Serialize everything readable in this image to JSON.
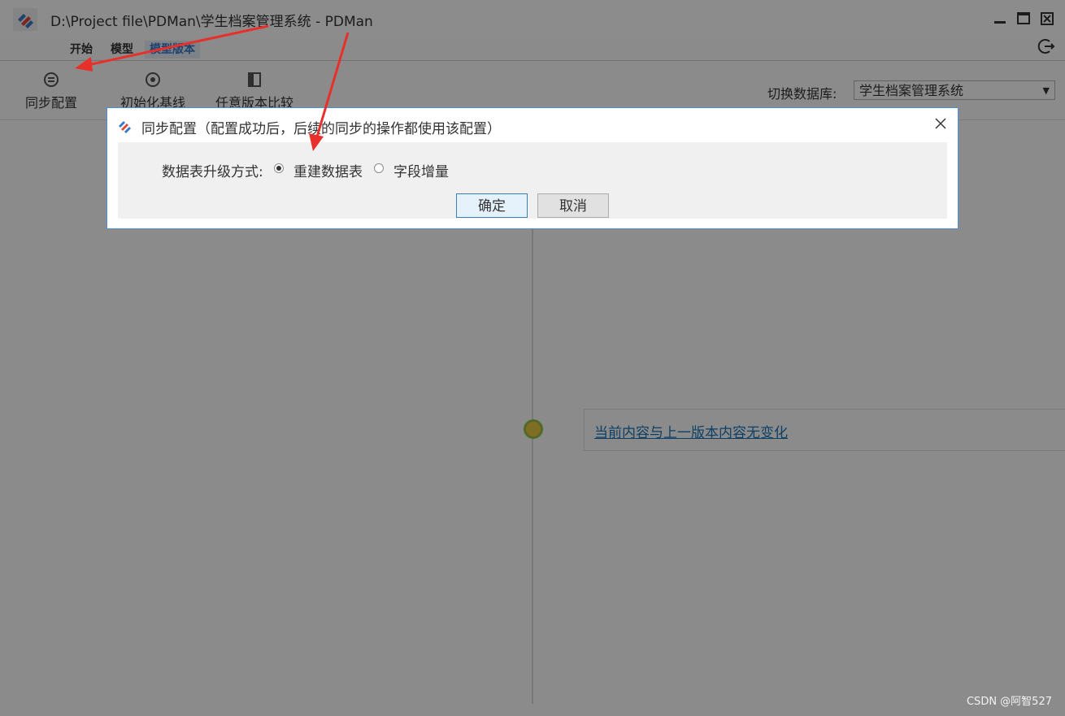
{
  "window": {
    "title": "D:\\Project file\\PDMan\\学生档案管理系统 - PDMan",
    "minimize_icon": "minimize-icon",
    "maximize_icon": "maximize-icon",
    "close_icon": "close-icon"
  },
  "menu": {
    "tabs": [
      {
        "label": "开始"
      },
      {
        "label": "模型"
      },
      {
        "label": "模型版本"
      }
    ],
    "active_tab": "模型版本",
    "logout_icon": "logout-icon"
  },
  "toolbar": {
    "sync_config": "同步配置",
    "init_baseline": "初始化基线",
    "compare_versions": "任意版本比较",
    "switch_db_label": "切换数据库:",
    "db_selected": "学生档案管理系统"
  },
  "timeline": {
    "message": "当前内容与上一版本内容无变化"
  },
  "dialog": {
    "title": "同步配置（配置成功后，后续的同步的操作都使用该配置）",
    "field_label": "数据表升级方式:",
    "options": [
      {
        "label": "重建数据表",
        "checked": true
      },
      {
        "label": "字段增量",
        "checked": false
      }
    ],
    "ok": "确定",
    "cancel": "取消"
  },
  "watermark": "CSDN @阿智527",
  "colors": {
    "accent": "#3a78c8",
    "link": "#1a76b9",
    "annotation_arrow": "#e8302a",
    "dialog_border": "#4a90d9"
  }
}
